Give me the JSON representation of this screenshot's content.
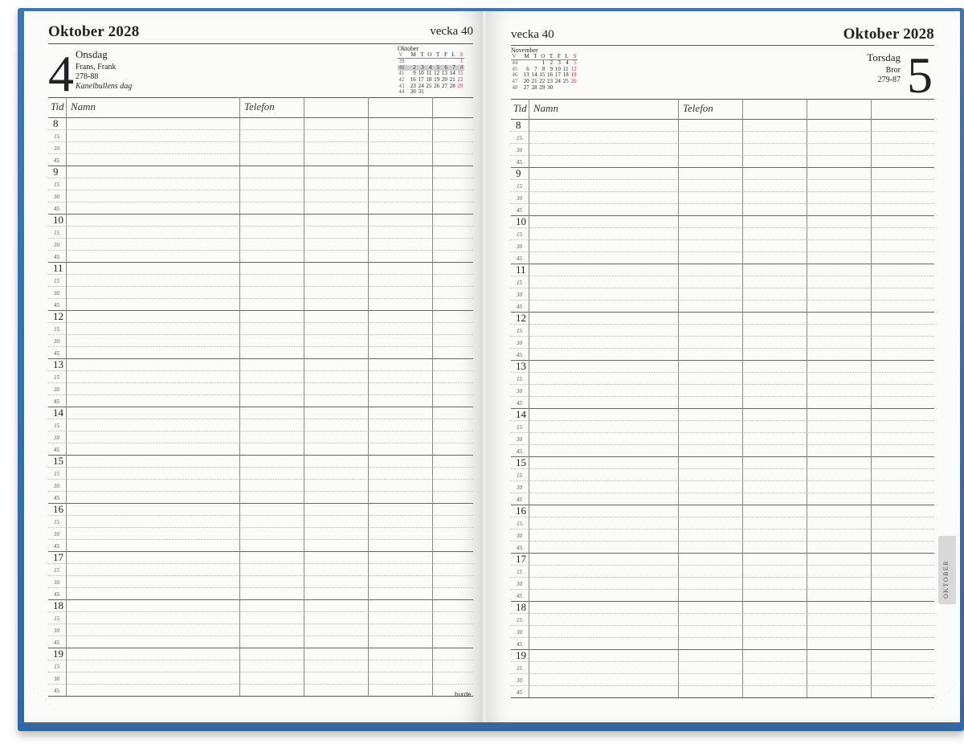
{
  "left": {
    "month_title": "Oktober 2028",
    "week": "vecka 40",
    "day_number": "4",
    "day_name": "Onsdag",
    "names": "Frans, Frank",
    "day_of_year": "278-88",
    "note": "Kanelbullens dag",
    "mini_cal": {
      "title": "Oktober",
      "headers": [
        "V",
        "M",
        "T",
        "O",
        "T",
        "F",
        "L",
        "S"
      ],
      "rows": [
        [
          "39",
          "",
          "",
          "",
          "",
          "",
          "",
          "1"
        ],
        [
          "40",
          "2",
          "3",
          "4",
          "5",
          "6",
          "7",
          "8"
        ],
        [
          "41",
          "9",
          "10",
          "11",
          "12",
          "13",
          "14",
          "15"
        ],
        [
          "42",
          "16",
          "17",
          "18",
          "19",
          "20",
          "21",
          "22"
        ],
        [
          "43",
          "23",
          "24",
          "25",
          "26",
          "27",
          "28",
          "29"
        ],
        [
          "44",
          "30",
          "31",
          "",
          "",
          "",
          "",
          ""
        ]
      ],
      "highlight_row": 1
    },
    "brand": "burde"
  },
  "right": {
    "month_title": "Oktober 2028",
    "week": "vecka 40",
    "day_number": "5",
    "day_name": "Torsdag",
    "names": "Bror",
    "day_of_year": "279-87",
    "mini_cal": {
      "title": "November",
      "headers": [
        "V",
        "M",
        "T",
        "O",
        "T",
        "F",
        "L",
        "S"
      ],
      "rows": [
        [
          "44",
          "",
          "",
          "1",
          "2",
          "3",
          "4",
          "5"
        ],
        [
          "45",
          "6",
          "7",
          "8",
          "9",
          "10",
          "11",
          "12"
        ],
        [
          "46",
          "13",
          "14",
          "15",
          "16",
          "17",
          "18",
          "19"
        ],
        [
          "47",
          "20",
          "21",
          "22",
          "23",
          "24",
          "25",
          "26"
        ],
        [
          "48",
          "27",
          "28",
          "29",
          "30",
          "",
          "",
          ""
        ]
      ],
      "highlight_row": -1
    },
    "tab_label": "OKTOBER"
  },
  "grid": {
    "headers": {
      "tid": "Tid",
      "namn": "Namn",
      "telefon": "Telefon"
    },
    "hours": [
      "8",
      "9",
      "10",
      "11",
      "12",
      "13",
      "14",
      "15",
      "16",
      "17",
      "18",
      "19"
    ],
    "quarters": [
      "15",
      "30",
      "45"
    ]
  }
}
